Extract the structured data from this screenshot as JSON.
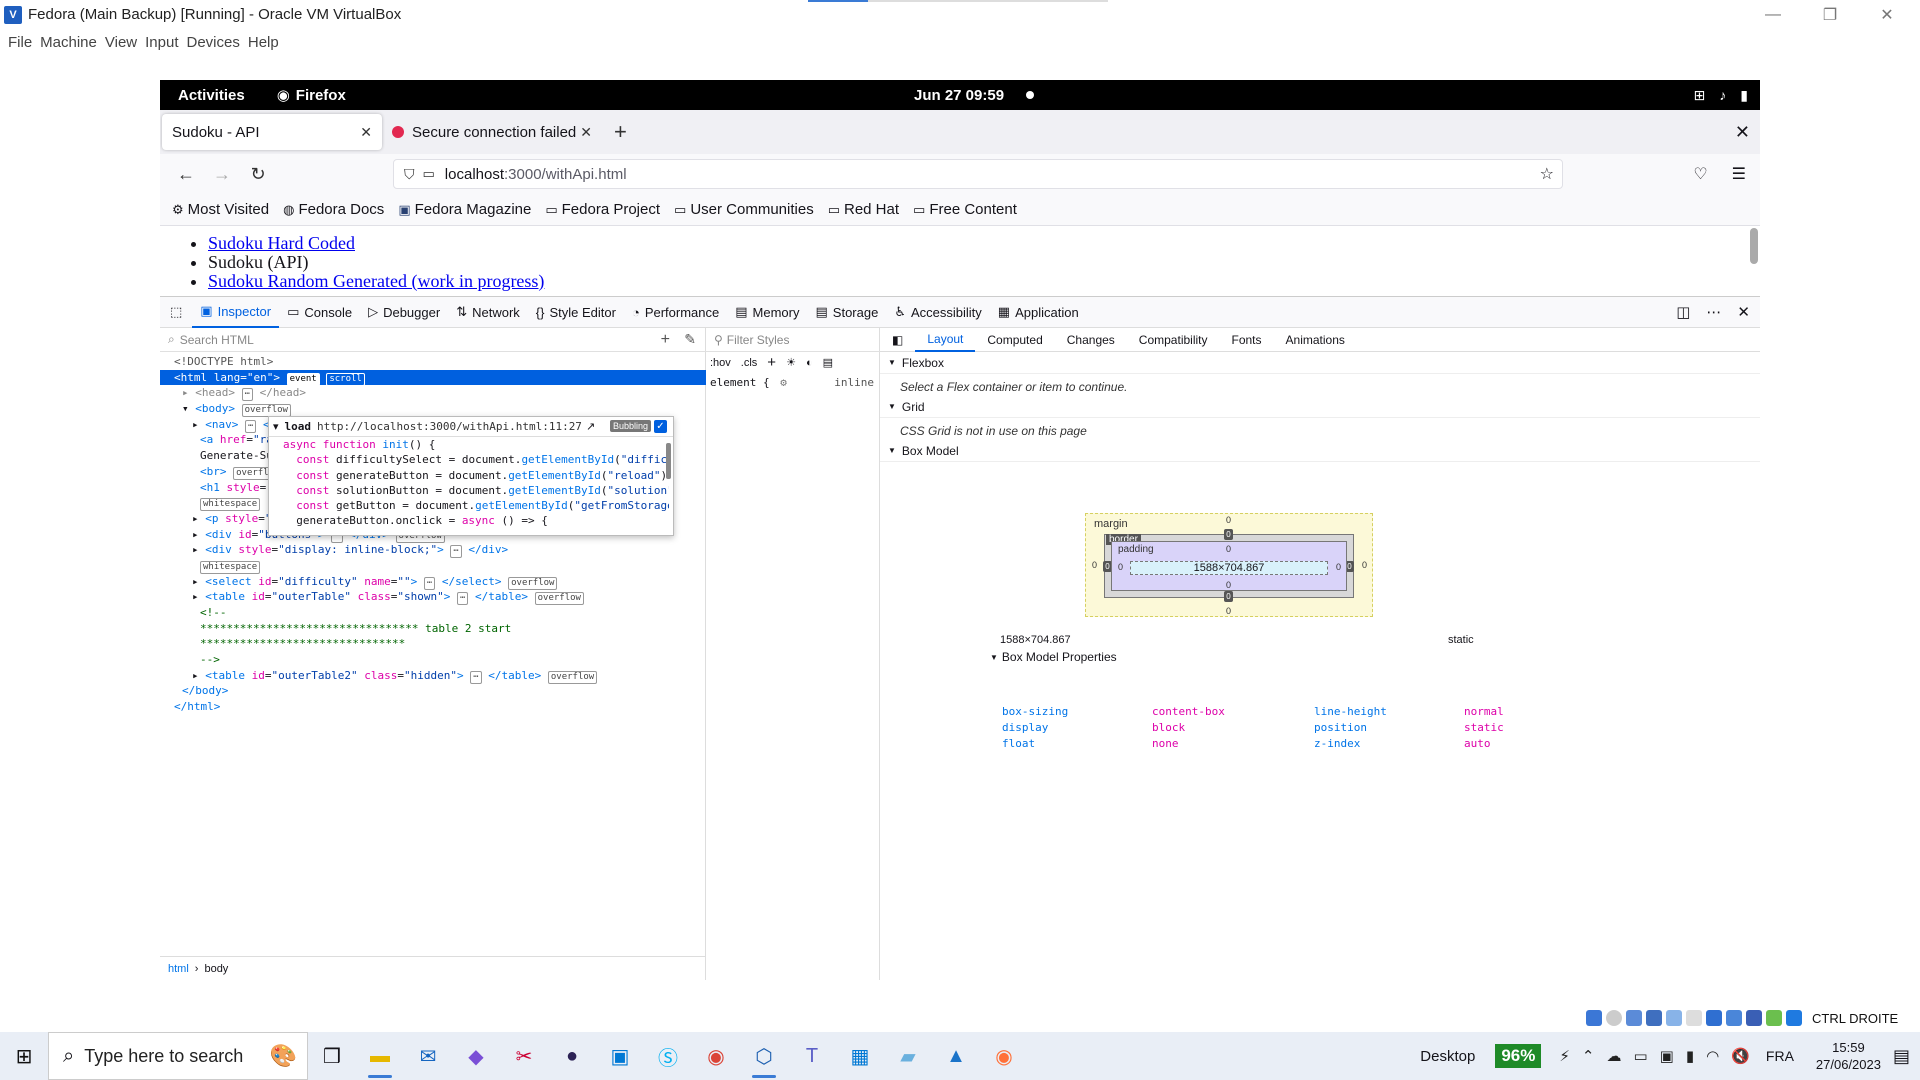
{
  "vbox": {
    "title": "Fedora (Main Backup) [Running] - Oracle VM VirtualBox",
    "menu": [
      "File",
      "Machine",
      "View",
      "Input",
      "Devices",
      "Help"
    ]
  },
  "gnome": {
    "activities": "Activities",
    "app": "Firefox",
    "clock": "Jun 27  09:59"
  },
  "browser": {
    "tabs": [
      {
        "label": "Sudoku - API"
      },
      {
        "label": "Secure connection failed"
      }
    ],
    "url_host": "localhost",
    "url_path": ":3000/withApi.html",
    "bookmarks": [
      "Most Visited",
      "Fedora Docs",
      "Fedora Magazine",
      "Fedora Project",
      "User Communities",
      "Red Hat",
      "Free Content"
    ]
  },
  "page": {
    "links": [
      "Sudoku Hard Coded",
      "Sudoku (API)",
      "Sudoku Random Generated (work in progress)"
    ]
  },
  "devtools": {
    "tools": [
      "Inspector",
      "Console",
      "Debugger",
      "Network",
      "Style Editor",
      "Performance",
      "Memory",
      "Storage",
      "Accessibility",
      "Application"
    ],
    "search_placeholder": "Search HTML",
    "filter_placeholder": "Filter Styles",
    "rules": {
      "hov": ":hov",
      "cls": ".cls",
      "element": "element {",
      "inline": "inline"
    },
    "layout_tabs": [
      "Layout",
      "Computed",
      "Changes",
      "Compatibility",
      "Fonts",
      "Animations"
    ],
    "flexbox": {
      "title": "Flexbox",
      "msg": "Select a Flex container or item to continue."
    },
    "grid": {
      "title": "Grid",
      "msg": "CSS Grid is not in use on this page"
    },
    "boxmodel": {
      "title": "Box Model",
      "margin": "margin",
      "border": "border",
      "padding": "padding",
      "content": "1588×704.867",
      "size": "1588×704.867",
      "position": "static",
      "props_title": "Box Model Properties",
      "props": [
        {
          "n": "box-sizing",
          "v": "content-box",
          "n2": "line-height",
          "v2": "normal"
        },
        {
          "n": "display",
          "v": "block",
          "n2": "position",
          "v2": "static"
        },
        {
          "n": "float",
          "v": "none",
          "n2": "z-index",
          "v2": "auto"
        }
      ]
    },
    "event": {
      "name": "load",
      "location": "http://localhost:3000/withApi.html:11:27",
      "bubbling": "Bubbling"
    },
    "crumbs": [
      "html",
      "body"
    ]
  },
  "taskbar": {
    "search": "Type here to search",
    "desktop": "Desktop",
    "battery": "96%",
    "lang": "FRA",
    "time": "15:59",
    "date": "27/06/2023",
    "host_key": "CTRL DROITE"
  }
}
